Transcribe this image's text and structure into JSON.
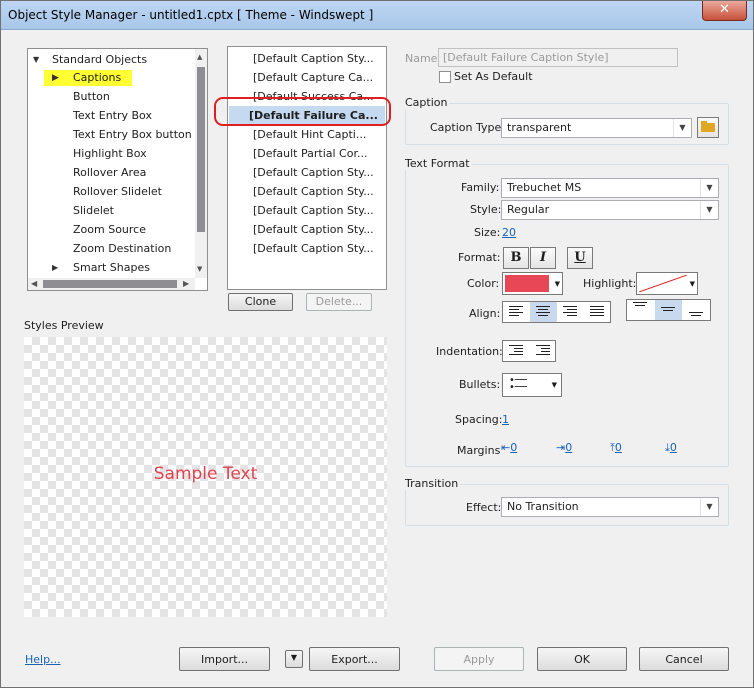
{
  "window": {
    "title": "Object Style Manager - untitled1.cptx [ Theme - Windswept ]"
  },
  "tree": {
    "items": [
      {
        "label": "Standard Objects",
        "expander": "expanded"
      },
      {
        "label": "Captions",
        "expander": "selected"
      },
      {
        "label": "Button"
      },
      {
        "label": "Text Entry Box"
      },
      {
        "label": "Text Entry Box button"
      },
      {
        "label": "Highlight Box"
      },
      {
        "label": "Rollover Area"
      },
      {
        "label": "Rollover Slidelet"
      },
      {
        "label": "Slidelet"
      },
      {
        "label": "Zoom Source"
      },
      {
        "label": "Zoom Destination"
      },
      {
        "label": "Smart Shapes",
        "expander": "collapsed"
      }
    ],
    "highlight_color": "#ffff33"
  },
  "styles_list": {
    "items": [
      {
        "label": "[Default Caption Sty..."
      },
      {
        "label": "[Default Capture Ca..."
      },
      {
        "label": "[Default Success Ca..."
      },
      {
        "label": "[Default Failure Ca...",
        "selected": true
      },
      {
        "label": "[Default Hint Capti..."
      },
      {
        "label": "[Default Partial Cor..."
      },
      {
        "label": "[Default Caption Sty..."
      },
      {
        "label": "[Default Caption Sty..."
      },
      {
        "label": "[Default Caption Sty..."
      },
      {
        "label": "[Default Caption Sty..."
      },
      {
        "label": "[Default Caption Sty..."
      }
    ],
    "selection_outline_color": "#e02020"
  },
  "list_buttons": {
    "clone": "Clone",
    "delete": "Delete..."
  },
  "preview": {
    "heading": "Styles Preview",
    "sample_text": "Sample Text",
    "sample_color": "#e0434f"
  },
  "name_field": {
    "label": "Name",
    "value": "[Default Failure Caption Style]",
    "set_default_label": "Set As Default"
  },
  "caption_group": {
    "title": "Caption",
    "caption_type_label": "Caption Type",
    "caption_type_value": "transparent"
  },
  "text_format": {
    "title": "Text Format",
    "family_label": "Family:",
    "family_value": "Trebuchet MS",
    "style_label": "Style:",
    "style_value": "Regular",
    "size_label": "Size:",
    "size_value": "20",
    "format_label": "Format:",
    "bold": "B",
    "italic": "I",
    "underline": "U",
    "color_label": "Color:",
    "color_value": "#e84855",
    "highlight_label": "Highlight:",
    "align_label": "Align:",
    "indentation_label": "Indentation:",
    "bullets_label": "Bullets:",
    "spacing_label": "Spacing:",
    "spacing_value": "1",
    "margins_label": "Margins",
    "margins": [
      "0",
      "0",
      "0",
      "0"
    ]
  },
  "transition": {
    "title": "Transition",
    "effect_label": "Effect:",
    "effect_value": "No Transition"
  },
  "footer": {
    "help": "Help...",
    "import": "Import...",
    "export": "Export...",
    "apply": "Apply",
    "ok": "OK",
    "cancel": "Cancel"
  }
}
